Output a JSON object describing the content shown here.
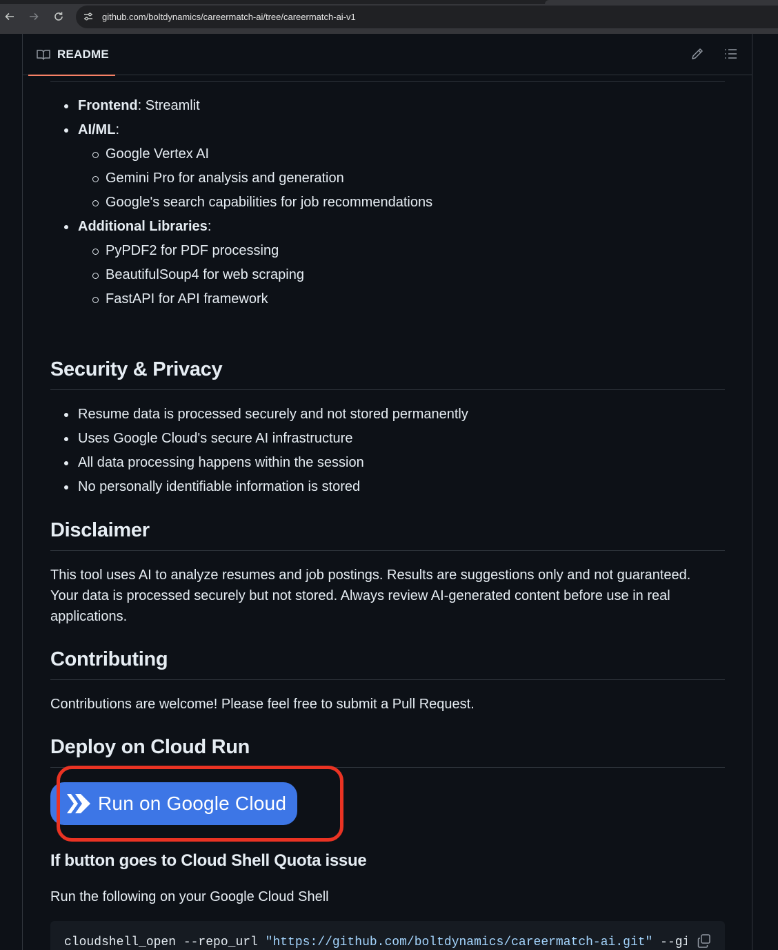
{
  "browser": {
    "url": "github.com/boltdynamics/careermatch-ai/tree/careermatch-ai-v1"
  },
  "readme": {
    "tab_label": "README",
    "tech_stack": [
      {
        "label": "Frontend",
        "text": ": Streamlit",
        "subitems": []
      },
      {
        "label": "AI/ML",
        "text": ":",
        "subitems": [
          "Google Vertex AI",
          "Gemini Pro for analysis and generation",
          "Google's search capabilities for job recommendations"
        ]
      },
      {
        "label": "Additional Libraries",
        "text": ":",
        "subitems": [
          "PyPDF2 for PDF processing",
          "BeautifulSoup4 for web scraping",
          "FastAPI for API framework"
        ]
      }
    ],
    "security": {
      "heading": "Security & Privacy",
      "items": [
        "Resume data is processed securely and not stored permanently",
        "Uses Google Cloud's secure AI infrastructure",
        "All data processing happens within the session",
        "No personally identifiable information is stored"
      ]
    },
    "disclaimer": {
      "heading": "Disclaimer",
      "text_lines": [
        "This tool uses AI to analyze resumes and job postings. Results are suggestions only and not guaranteed.",
        "Your data is processed securely but not stored. Always review AI-generated content before use in real",
        "applications."
      ]
    },
    "contributing": {
      "heading": "Contributing",
      "text": "Contributions are welcome! Please feel free to submit a Pull Request."
    },
    "deploy": {
      "heading": "Deploy on Cloud Run",
      "button_label": "Run on Google Cloud",
      "subheading": "If button goes to Cloud Shell Quota issue",
      "instruction": "Run the following on your Google Cloud Shell",
      "code": {
        "command": "cloudshell_open --repo_url ",
        "repo_url": "\"https://github.com/boltdynamics/careermatch-ai.git\"",
        "flag": " --git_branch"
      }
    }
  },
  "colors": {
    "accent_underline": "#f78166",
    "highlight_border": "#ea3323",
    "gc_button": "#3d76e6",
    "code_string": "#a5d6ff"
  }
}
